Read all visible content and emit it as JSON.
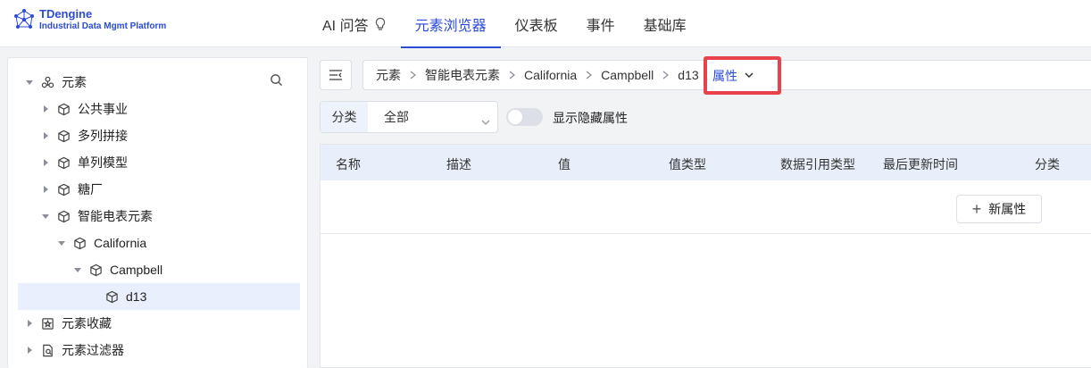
{
  "app": {
    "name": "TDengine",
    "subtitle": "Industrial Data Mgmt Platform",
    "accent": "#2b4bd8"
  },
  "nav": [
    {
      "label": "AI 问答",
      "icon": "lightbulb-icon",
      "active": false
    },
    {
      "label": "元素浏览器",
      "active": true
    },
    {
      "label": "仪表板",
      "active": false
    },
    {
      "label": "事件",
      "active": false
    },
    {
      "label": "基础库",
      "active": false
    }
  ],
  "sidebar": {
    "search_icon": "search-icon",
    "tree": [
      {
        "label": "元素",
        "icon": "elements-icon",
        "expanded": true
      },
      {
        "label": "公共事业",
        "icon": "cube-icon",
        "expanded": false
      },
      {
        "label": "多列拼接",
        "icon": "cube-icon",
        "expanded": false
      },
      {
        "label": "单列模型",
        "icon": "cube-icon",
        "expanded": false
      },
      {
        "label": "糖厂",
        "icon": "cube-icon",
        "expanded": false
      },
      {
        "label": "智能电表元素",
        "icon": "cube-icon",
        "expanded": true
      },
      {
        "label": "California",
        "icon": "cube-icon",
        "expanded": true
      },
      {
        "label": "Campbell",
        "icon": "cube-icon",
        "expanded": true
      },
      {
        "label": "d13",
        "icon": "cube-icon",
        "selected": true
      },
      {
        "label": "元素收藏",
        "icon": "star-box-icon",
        "expanded": false
      },
      {
        "label": "元素过滤器",
        "icon": "filter-doc-icon",
        "expanded": false
      }
    ]
  },
  "breadcrumb": {
    "items": [
      "元素",
      "智能电表元素",
      "California",
      "Campbell",
      "d13"
    ],
    "active": "属性",
    "highlight_color": "#e8424c"
  },
  "filters": {
    "category_label": "分类",
    "category_value": "全部",
    "show_hidden_label": "显示隐藏属性",
    "show_hidden_on": false
  },
  "table": {
    "columns": [
      "名称",
      "描述",
      "值",
      "值类型",
      "数据引用类型",
      "最后更新时间",
      "分类"
    ],
    "new_button": "新属性"
  }
}
